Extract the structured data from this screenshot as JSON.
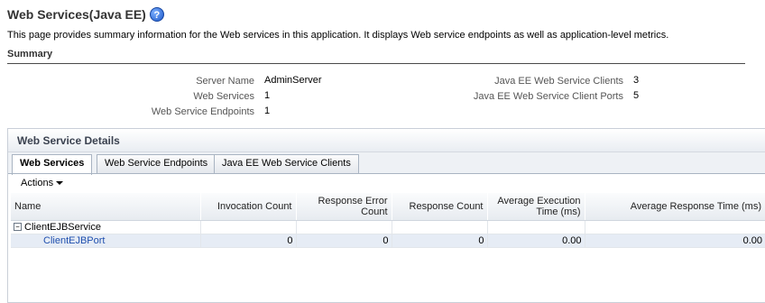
{
  "page": {
    "title": "Web Services(Java EE)",
    "help_label": "?",
    "description": "This page provides summary information for the Web services in this application. It displays Web service endpoints as well as application-level metrics."
  },
  "summary": {
    "heading": "Summary",
    "left": [
      {
        "label": "Server Name",
        "value": "AdminServer"
      },
      {
        "label": "Web Services",
        "value": "1"
      },
      {
        "label": "Web Service Endpoints",
        "value": "1"
      }
    ],
    "right": [
      {
        "label": "Java EE Web Service Clients",
        "value": "3"
      },
      {
        "label": "Java EE Web Service Client Ports",
        "value": "5"
      }
    ]
  },
  "details": {
    "heading": "Web Service Details",
    "tabs": [
      "Web Services",
      "Web Service Endpoints",
      "Java EE Web Service Clients"
    ],
    "actions_label": "Actions",
    "columns": [
      "Name",
      "Invocation Count",
      "Response Error Count",
      "Response Count",
      "Average Execution Time (ms)",
      "Average Response Time (ms)"
    ],
    "rows": [
      {
        "name": "ClientEJBService",
        "expander": "−",
        "cells": [
          "",
          "",
          "",
          "",
          ""
        ]
      },
      {
        "name": "ClientEJBPort",
        "cells": [
          "0",
          "0",
          "0",
          "0.00",
          "0.00"
        ]
      }
    ]
  }
}
